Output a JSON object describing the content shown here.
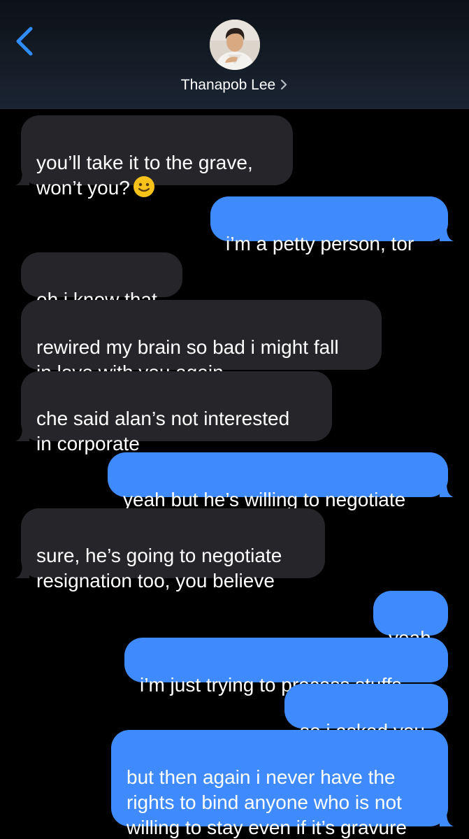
{
  "header": {
    "contact_name": "Thanapob Lee",
    "back_icon": "chevron-left-icon",
    "name_chevron_icon": "chevron-right-icon"
  },
  "colors": {
    "incoming_bubble": "#26262a",
    "outgoing_bubble": "#3f8bfd",
    "accent": "#2f8dff"
  },
  "messages": [
    {
      "direction": "in",
      "text": "you’ll take it to the grave,\nwon’t you?",
      "emoji": "slightly-smiling-face-icon"
    },
    {
      "direction": "out",
      "text": "i’m a petty person, tor"
    },
    {
      "direction": "in",
      "text": "oh i know that"
    },
    {
      "direction": "in",
      "text": "rewired my brain so bad i might fall\nin love with you again"
    },
    {
      "direction": "in",
      "text": "che said alan’s not interested\nin corporate"
    },
    {
      "direction": "out",
      "text": "yeah but he’s willing to negotiate"
    },
    {
      "direction": "in",
      "text": "sure, he’s going to negotiate\nresignation too, you believe"
    },
    {
      "direction": "out",
      "text": "yeah"
    },
    {
      "direction": "out",
      "text": "i’m just trying to process stuffs"
    },
    {
      "direction": "out",
      "text": "so i asked you"
    },
    {
      "direction": "out",
      "text": "but then again i never have the\nrights to bind anyone who is not\nwilling to stay even if it’s gravure"
    }
  ]
}
